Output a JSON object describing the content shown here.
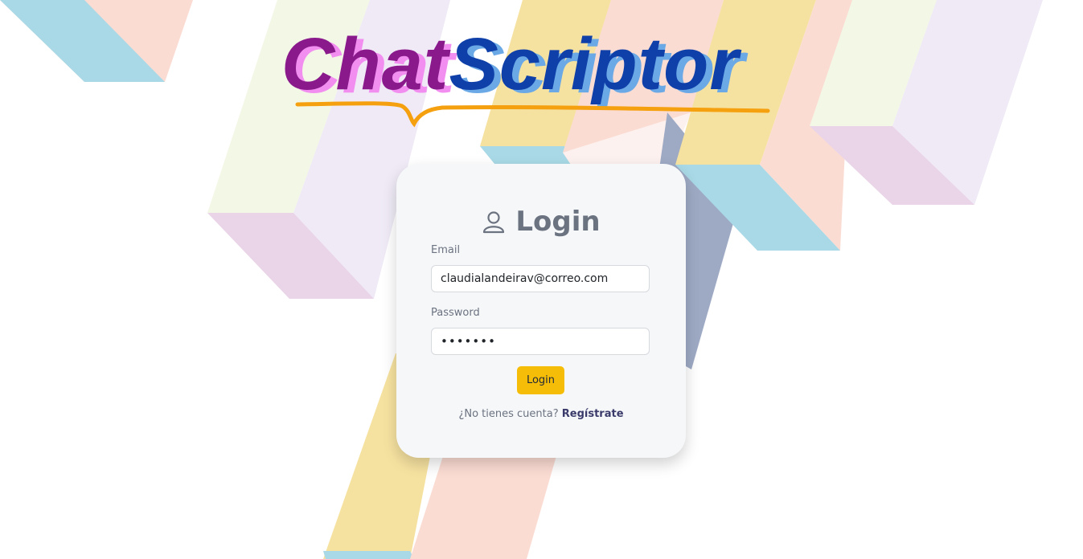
{
  "brand": {
    "part1": "Chat",
    "part2": "Scriptor"
  },
  "login": {
    "title": "Login",
    "email_label": "Email",
    "email_value": "claudialandeirav@correo.com",
    "password_label": "Password",
    "password_value": "•••••••",
    "submit_label": "Login",
    "no_account_text": "¿No tienes cuenta?",
    "register_link": "Regístrate"
  },
  "icons": {
    "title_icon": "person-icon"
  },
  "colors": {
    "brand_chat": "#8a1a8c",
    "brand_chat_shadow": "#f28ef0",
    "brand_scriptor": "#0f3fa8",
    "brand_scriptor_shadow": "#6aa8e6",
    "underline": "#f5a00f",
    "button": "#f6bd08",
    "card_bg": "#f6f7f9"
  }
}
